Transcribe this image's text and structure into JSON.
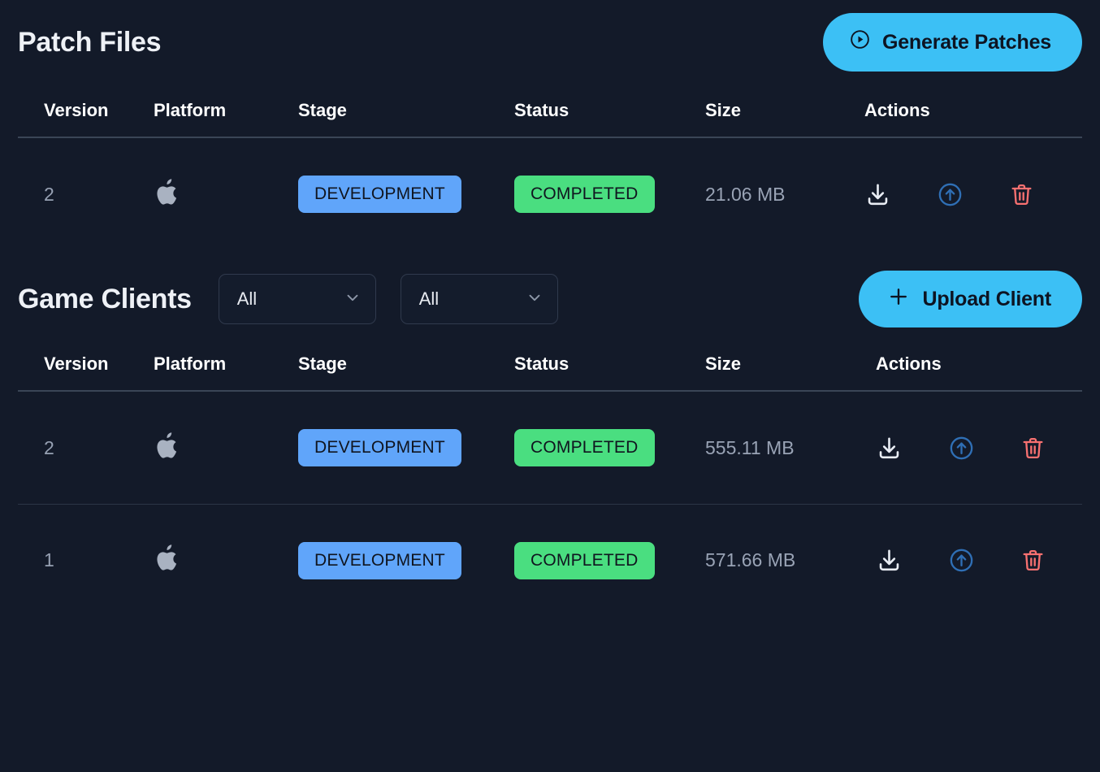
{
  "patch_files": {
    "title": "Patch Files",
    "generate_button": {
      "label": "Generate Patches",
      "icon": "play-circle-icon"
    },
    "columns": [
      "Version",
      "Platform",
      "Stage",
      "Status",
      "Size",
      "Actions"
    ],
    "rows": [
      {
        "version": "2",
        "platform_icon": "apple-icon",
        "stage": "DEVELOPMENT",
        "status": "COMPLETED",
        "size": "21.06 MB",
        "actions": [
          "download-icon",
          "upload-circle-icon",
          "trash-icon"
        ]
      }
    ]
  },
  "game_clients": {
    "title": "Game Clients",
    "filters": [
      {
        "value": "All",
        "icon": "chevron-down-icon"
      },
      {
        "value": "All",
        "icon": "chevron-down-icon"
      }
    ],
    "upload_button": {
      "label": "Upload Client",
      "icon": "plus-icon"
    },
    "columns": [
      "Version",
      "Platform",
      "Stage",
      "Status",
      "Size",
      "Actions"
    ],
    "rows": [
      {
        "version": "2",
        "platform_icon": "apple-icon",
        "stage": "DEVELOPMENT",
        "status": "COMPLETED",
        "size": "555.11 MB",
        "actions": [
          "download-icon",
          "upload-circle-icon",
          "trash-icon"
        ]
      },
      {
        "version": "1",
        "platform_icon": "apple-icon",
        "stage": "DEVELOPMENT",
        "status": "COMPLETED",
        "size": "571.66 MB",
        "actions": [
          "download-icon",
          "upload-circle-icon",
          "trash-icon"
        ]
      }
    ]
  },
  "colors": {
    "background": "#131a29",
    "accent": "#3cc0f5",
    "stage_badge": "#60a5fa",
    "status_badge": "#4ade80",
    "download_icon": "#e9edf4",
    "upload_icon": "#2f6fb5",
    "trash_icon": "#f87171",
    "divider": "#3a4556"
  }
}
